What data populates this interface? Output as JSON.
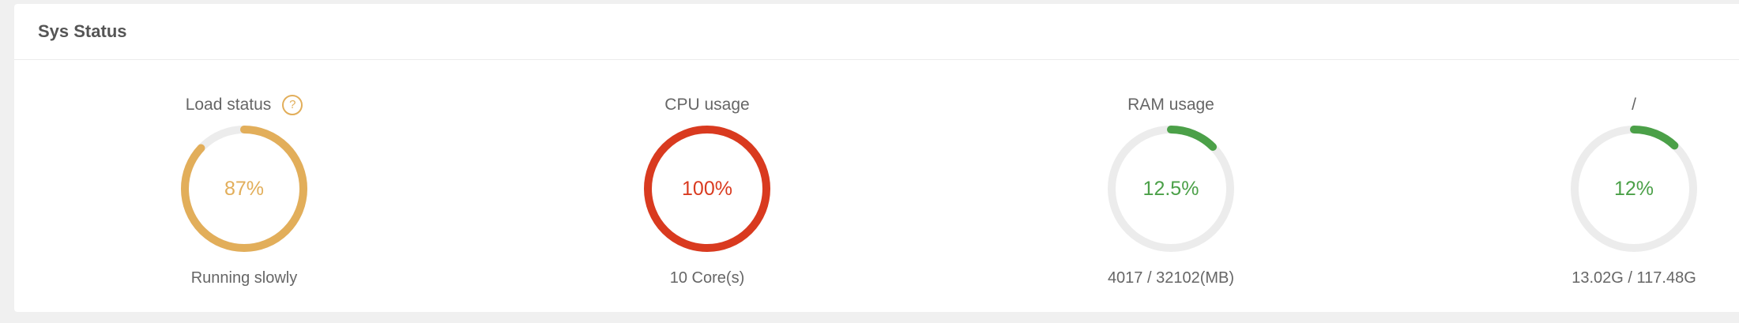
{
  "panel": {
    "title": "Sys Status"
  },
  "gauges": [
    {
      "label": "Load status",
      "help_icon": "question-circle-icon",
      "help_glyph": "?",
      "value_text": "87%",
      "percent": 87,
      "subtitle": "Running slowly",
      "color": "#e2ae5a"
    },
    {
      "label": "CPU usage",
      "value_text": "100%",
      "percent": 100,
      "subtitle": "10 Core(s)",
      "color": "#d93a1f"
    },
    {
      "label": "RAM usage",
      "value_text": "12.5%",
      "percent": 12.5,
      "subtitle": "4017 / 32102(MB)",
      "color": "#4ba048"
    },
    {
      "label": "/",
      "value_text": "12%",
      "percent": 12,
      "subtitle": "13.02G / 117.48G",
      "color": "#4ba048"
    }
  ],
  "colors": {
    "track": "#ececec",
    "text_muted": "#666666",
    "title": "#555555"
  }
}
